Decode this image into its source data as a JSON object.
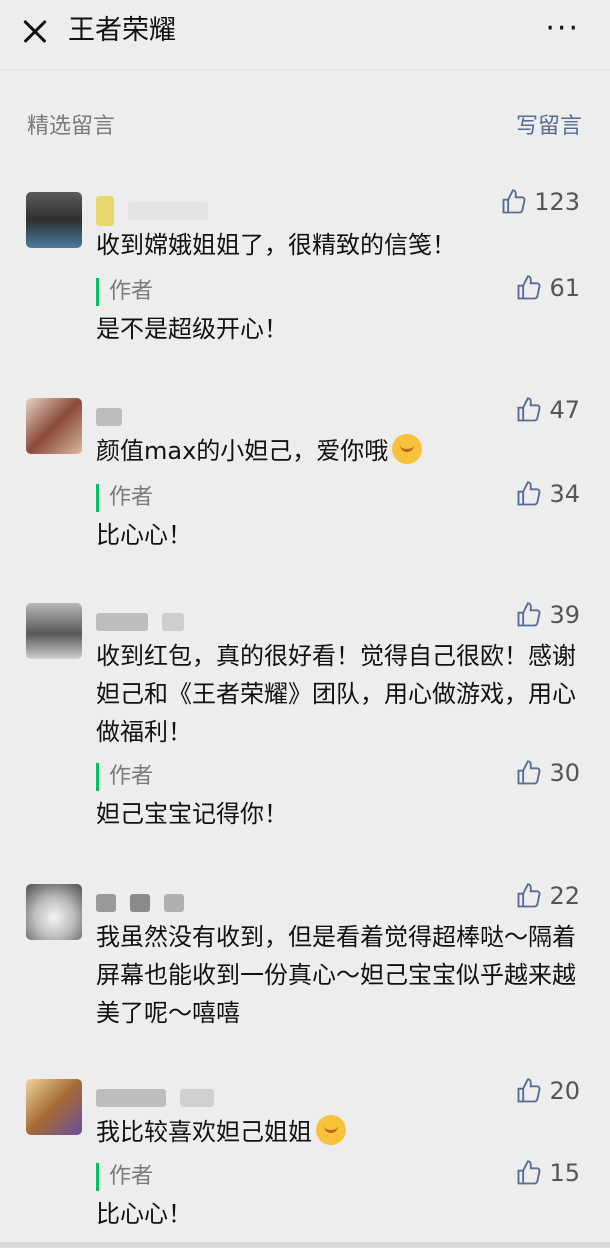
{
  "header": {
    "title": "王者荣耀",
    "more_label": "···"
  },
  "section": {
    "label": "精选留言",
    "write_label": "写留言"
  },
  "comments": [
    {
      "text": "收到嫦娥姐姐了，很精致的信笺！",
      "likes": "123",
      "reply": {
        "label": "作者",
        "text": "是不是超级开心！",
        "likes": "61"
      }
    },
    {
      "text": "颜值max的小妲己，爱你哦",
      "likes": "47",
      "reply": {
        "label": "作者",
        "text": "比心心！",
        "likes": "34"
      }
    },
    {
      "text": "收到红包，真的很好看！觉得自己很欧！感谢妲己和《王者荣耀》团队，用心做游戏，用心做福利！",
      "likes": "39",
      "reply": {
        "label": "作者",
        "text": "妲己宝宝记得你！",
        "likes": "30"
      }
    },
    {
      "text": "我虽然没有收到，但是看着觉得超棒哒～隔着屏幕也能收到一份真心～妲己宝宝似乎越来越美了呢～嘻嘻",
      "likes": "22"
    },
    {
      "text": "我比较喜欢妲己姐姐",
      "likes": "20",
      "reply": {
        "label": "作者",
        "text": "比心心！",
        "likes": "15"
      }
    }
  ],
  "icons": {
    "like": "thumbs-up-icon",
    "close": "close-icon",
    "more": "more-icon",
    "emoji": "emoji-icon"
  },
  "colors": {
    "accent_green": "#07c160",
    "link_blue": "#576b95",
    "muted_text": "#7b7b7b"
  }
}
